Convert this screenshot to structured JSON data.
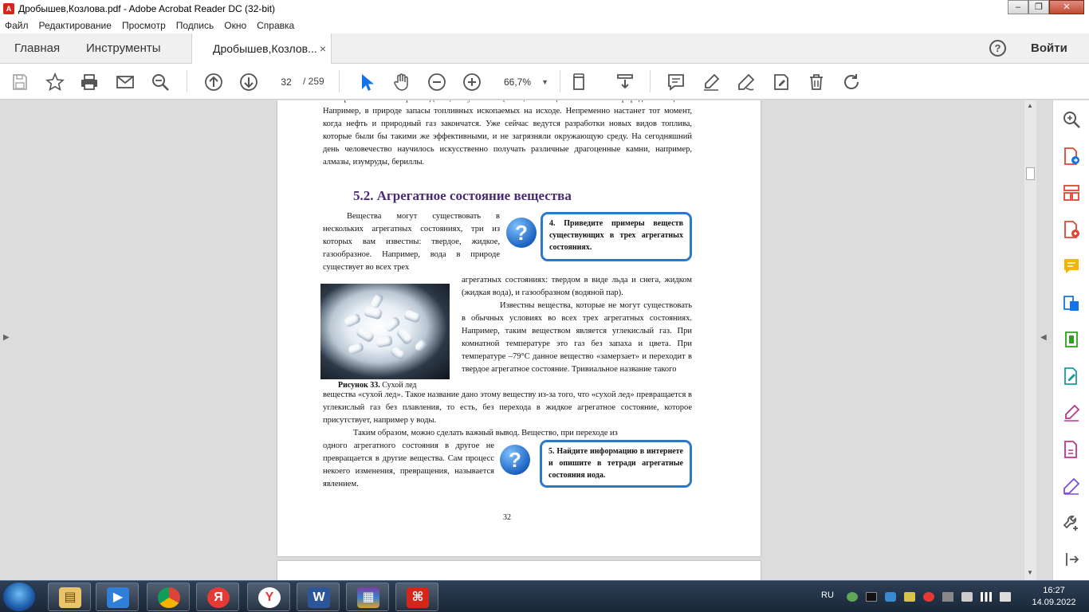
{
  "window": {
    "title": "Дробышев,Козлова.pdf - Adobe Acrobat Reader DC (32-bit)"
  },
  "menu": [
    "Файл",
    "Редактирование",
    "Просмотр",
    "Подпись",
    "Окно",
    "Справка"
  ],
  "tabs": {
    "home": "Главная",
    "tools": "Инструменты",
    "document": "Дробышев,Козлов...",
    "close": "×",
    "help": "?",
    "signin": "Войти"
  },
  "toolbar": {
    "page_current": "32",
    "page_total": "/ 259",
    "zoom": "66,7%"
  },
  "document": {
    "para1": "или промышленного производства, получать вещества, являющиеся аналогами природных веществ. Например, в природе запасы топливных ископаемых на исходе. Непременно настанет тот момент, когда нефть и природный газ закончатся. Уже сейчас ведутся разработки новых видов топлива, которые были бы такими же эффективными, и не загрязняли окружающую среду. На сегодняшний день человечество научилось искусственно получать различные драгоценные камни, например, алмазы, изумруды, бериллы.",
    "heading": "5.2. Агрегатное состояние вещества",
    "para2": "Вещества могут существовать в нескольких агрегатных состояниях, три из которых вам известны: твердое, жидкое, газообразное. Например, вода в природе существует во всех трех",
    "para3": "агрегатных состояниях: твердом в виде льда и снега, жидком (жидкая вода), и газообразном (водяной пар).",
    "para4": "Известны вещества, которые не могут существовать в обычных условиях во всех трех агрегатных состояниях. Например, таким веществом является углекислый газ. При комнатной температуре это газ без запаха и цвета. При температуре –79°С данное вещество «замерзает» и переходит в твердое агрегатное состояние. Тривиальное название такого",
    "para5": "вещества «сухой лед». Такое название дано этому веществу из-за того, что «сухой лед» превращается в углекислый газ без плавления, то есть, без перехода в жидкое агрегатное состояние, которое присутствует, например у воды.",
    "para6": "Таким образом, можно сделать важный вывод. Вещество, при переходе из",
    "para7": "одного агрегатного состояния в другое не превращается в другие вещества. Сам процесс некоего изменения, превращения, называется явлением.",
    "caption_bold": "Рисунок 33.",
    "caption_text": " Сухой лед",
    "q4": "4. Приведите примеры веществ существующих в трех агрегатных состояниях.",
    "q5": "5. Найдите информацию в интернете и опишите в тетради агрегатные состояния иода.",
    "q_icon": "?",
    "page_number": "32"
  },
  "taskbar": {
    "lang": "RU",
    "time": "16:27",
    "date": "14.09.2022",
    "apps": [
      "explorer",
      "media-player",
      "chrome",
      "yandex-browser",
      "yandex",
      "word",
      "winrar",
      "acrobat"
    ]
  }
}
